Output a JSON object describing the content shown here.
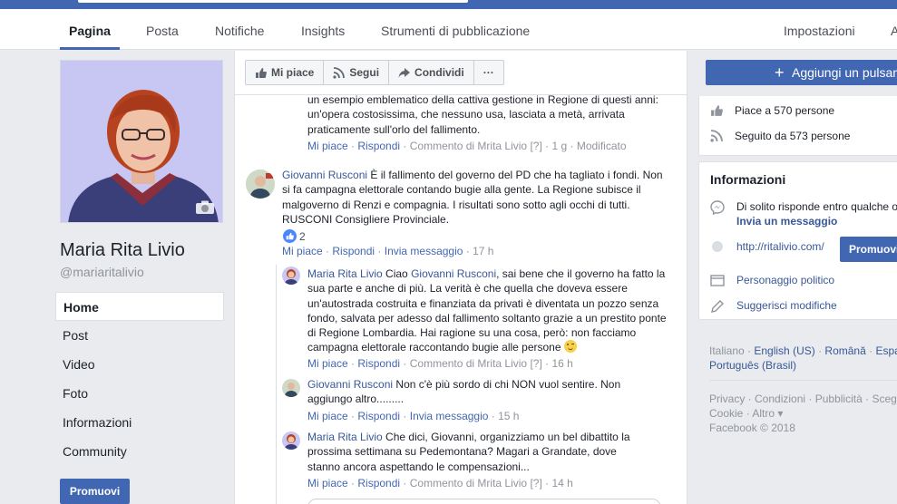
{
  "tabs": [
    {
      "label": "Pagina"
    },
    {
      "label": "Posta"
    },
    {
      "label": "Notifiche"
    },
    {
      "label": "Insights"
    },
    {
      "label": "Strumenti di pubblicazione"
    },
    {
      "label": "Impostazioni"
    },
    {
      "label": "A"
    }
  ],
  "page": {
    "name": "Maria Rita Livio",
    "handle": "@mariaritalivio"
  },
  "left_nav": [
    "Home",
    "Post",
    "Video",
    "Foto",
    "Informazioni",
    "Community"
  ],
  "promote_label": "Promuovi",
  "actions": {
    "like": "Mi piace",
    "follow": "Segui",
    "share": "Condividi",
    "more": "···"
  },
  "add_button": "Aggiungi un pulsante",
  "comments": {
    "c0": {
      "text": "un esempio emblematico della cattiva gestione in Regione di questi anni: un'opera costosissima, che nessuno usa, lasciata a metà, arrivata praticamente sull'orlo del fallimento.",
      "like": "Mi piace",
      "reply": "Rispondi",
      "info": "Commento di Mrita Livio",
      "q": "[?]",
      "time": "1 g",
      "edited": "Modificato"
    },
    "c1": {
      "author": "Giovanni Rusconi",
      "text": "È il fallimento del governo del PD che ha tagliato i fondi. Non si fa campagna elettorale contando bugie alla gente. La Regione subisce il malgoverno di Renzi e compagnia. I risultati sono sotto agli occhi di tutti. RUSCONI Consigliere Provinciale.",
      "like_count": "2",
      "like": "Mi piace",
      "reply": "Rispondi",
      "message": "Invia messaggio",
      "time": "17 h"
    },
    "c2": {
      "author": "Maria Rita Livio",
      "pre": "Ciao",
      "mention": "Giovanni Rusconi",
      "text": ", sai bene che il governo ha fatto la sua parte e anche di più. La verità è che quella che doveva essere un'autostrada costruita e finanziata da privati è diventata un pozzo senza fondo, salvata per adesso dal fallimento soltanto grazie a un prestito ponte di Regione Lombardia. Hai ragione su una cosa, però: non facciamo campagna elettorale raccontando bugie alle persone",
      "like": "Mi piace",
      "reply": "Rispondi",
      "info": "Commento di Mrita Livio",
      "q": "[?]",
      "time": "16 h"
    },
    "c3": {
      "author": "Giovanni Rusconi",
      "text": "Non c'è più sordo di chi NON vuol sentire. Non aggiungo altro.........",
      "like": "Mi piace",
      "reply": "Rispondi",
      "message": "Invia messaggio",
      "time": "15 h"
    },
    "c4": {
      "author": "Maria Rita Livio",
      "text": "Che dici, Giovanni, organizziamo un bel dibattito la prossima settimana su Pedemontana? Magari a Grandate, dove stanno ancora aspettando le compensazioni...",
      "like": "Mi piace",
      "reply": "Rispondi",
      "info": "Commento di Mrita Livio",
      "q": "[?]",
      "time": "14 h"
    }
  },
  "stats": {
    "likes": "Piace a 570 persone",
    "follows": "Seguito da 573 persone"
  },
  "info": {
    "title": "Informazioni",
    "response": "Di solito risponde entro qualche or",
    "send_message": "Invia un messaggio",
    "website": "http://ritalivio.com/",
    "promote": "Promuovi",
    "category": "Personaggio politico",
    "suggest": "Suggerisci modifiche"
  },
  "languages": {
    "l1": "Italiano",
    "l2": "English (US)",
    "l3": "Română",
    "l4": "Espa",
    "l5": "Português (Brasil)"
  },
  "footer": {
    "privacy": "Privacy",
    "terms": "Condizioni",
    "ads": "Pubblicità",
    "choices": "Sceg",
    "cookie": "Cookie",
    "other": "Altro",
    "copyright": "Facebook © 2018"
  },
  "colors": {
    "brand": "#4267b2",
    "link": "#385898",
    "meta": "#90949c",
    "bg": "#e9ebee"
  }
}
